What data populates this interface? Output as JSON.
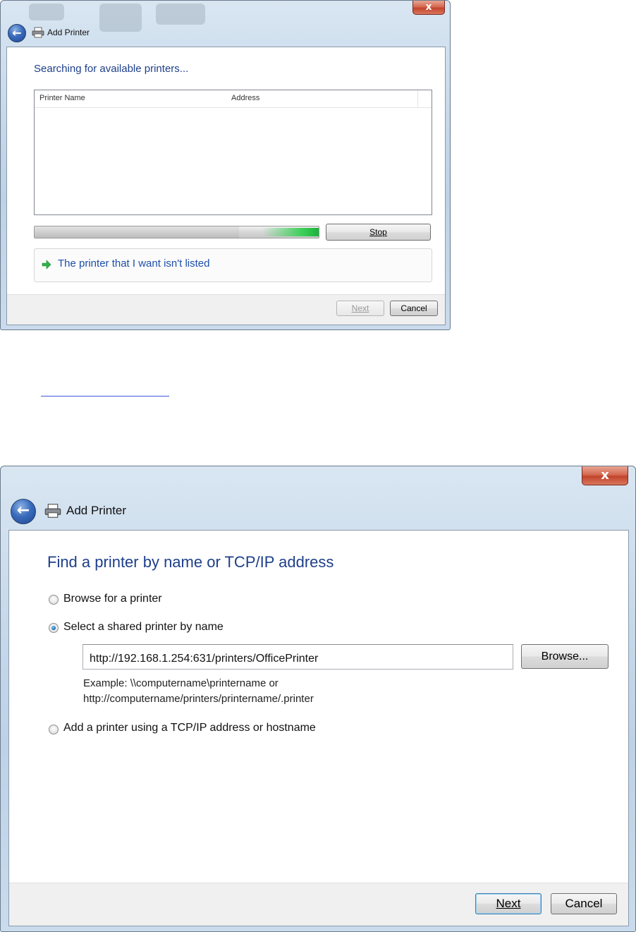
{
  "window1": {
    "title": "Add Printer",
    "close_glyph": "x",
    "back_icon": "back-arrow-icon",
    "heading": "Searching for available printers...",
    "columns": [
      "Printer Name",
      "Address"
    ],
    "progress": 0.72,
    "stop_label": "Stop",
    "not_listed_link": "The printer that I want isn't listed",
    "next_label": "Next",
    "cancel_label": "Cancel"
  },
  "window2": {
    "title": "Add Printer",
    "close_glyph": "x",
    "heading": "Find a printer by name or TCP/IP address",
    "options": [
      {
        "label": "Browse for a printer",
        "selected": false
      },
      {
        "label": "Select a shared printer by name",
        "selected": true
      },
      {
        "label": "Add a printer using a TCP/IP address or hostname",
        "selected": false
      }
    ],
    "printer_name_value": "http://192.168.1.254:631/printers/OfficePrinter",
    "browse_label": "Browse...",
    "example_line1": "Example: \\\\computername\\printername or",
    "example_line2": "http://computername/printers/printername/.printer",
    "next_label": "Next",
    "cancel_label": "Cancel"
  },
  "colors": {
    "heading_blue": "#1e3f8a",
    "link_blue": "#1e4fa8",
    "progress_green": "#1bb33b"
  }
}
